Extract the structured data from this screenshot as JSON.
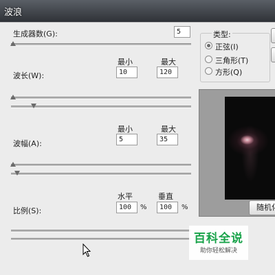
{
  "window": {
    "title": "波浪"
  },
  "generators": {
    "label": "生成器数(G):",
    "value": "5"
  },
  "wavelength": {
    "label": "波长(W):",
    "min_header": "最小",
    "max_header": "最大",
    "min": "10",
    "max": "120"
  },
  "amplitude": {
    "label": "波幅(A):",
    "min_header": "最小",
    "max_header": "最大",
    "min": "5",
    "max": "35"
  },
  "scale": {
    "label": "比例(S):",
    "h_header": "水平",
    "v_header": "垂直",
    "h": "100",
    "v": "100",
    "unit": "%"
  },
  "type": {
    "label": "类型:",
    "options": [
      {
        "label": "正弦(I)",
        "checked": true
      },
      {
        "label": "三角形(T)",
        "checked": false
      },
      {
        "label": "方形(Q)",
        "checked": false
      }
    ]
  },
  "buttons": {
    "randomize": "随机化"
  },
  "watermark": {
    "title": "百科全说",
    "subtitle": "助你轻松解决"
  },
  "colors": {
    "watermark_green": "#19a34a",
    "titlebar": "#2f3237"
  }
}
